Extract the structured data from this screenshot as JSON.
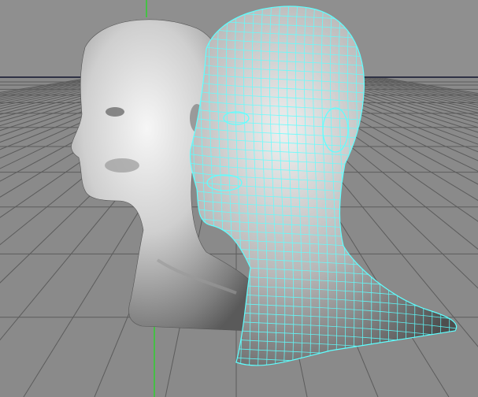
{
  "viewport": {
    "background_color": "#8f8f8f",
    "floor_color": "#8a8a8a",
    "grid_line_color": "#5c5c5c",
    "horizon_color": "#2f3245",
    "y_axis_color": "#2ed02e",
    "shaded_color": "#d8d8d8",
    "wireframe_color": "#5fffff"
  },
  "objects": [
    {
      "name": "head",
      "display": "smooth-shaded"
    },
    {
      "name": "head",
      "display": "wireframe-on-shaded"
    }
  ]
}
